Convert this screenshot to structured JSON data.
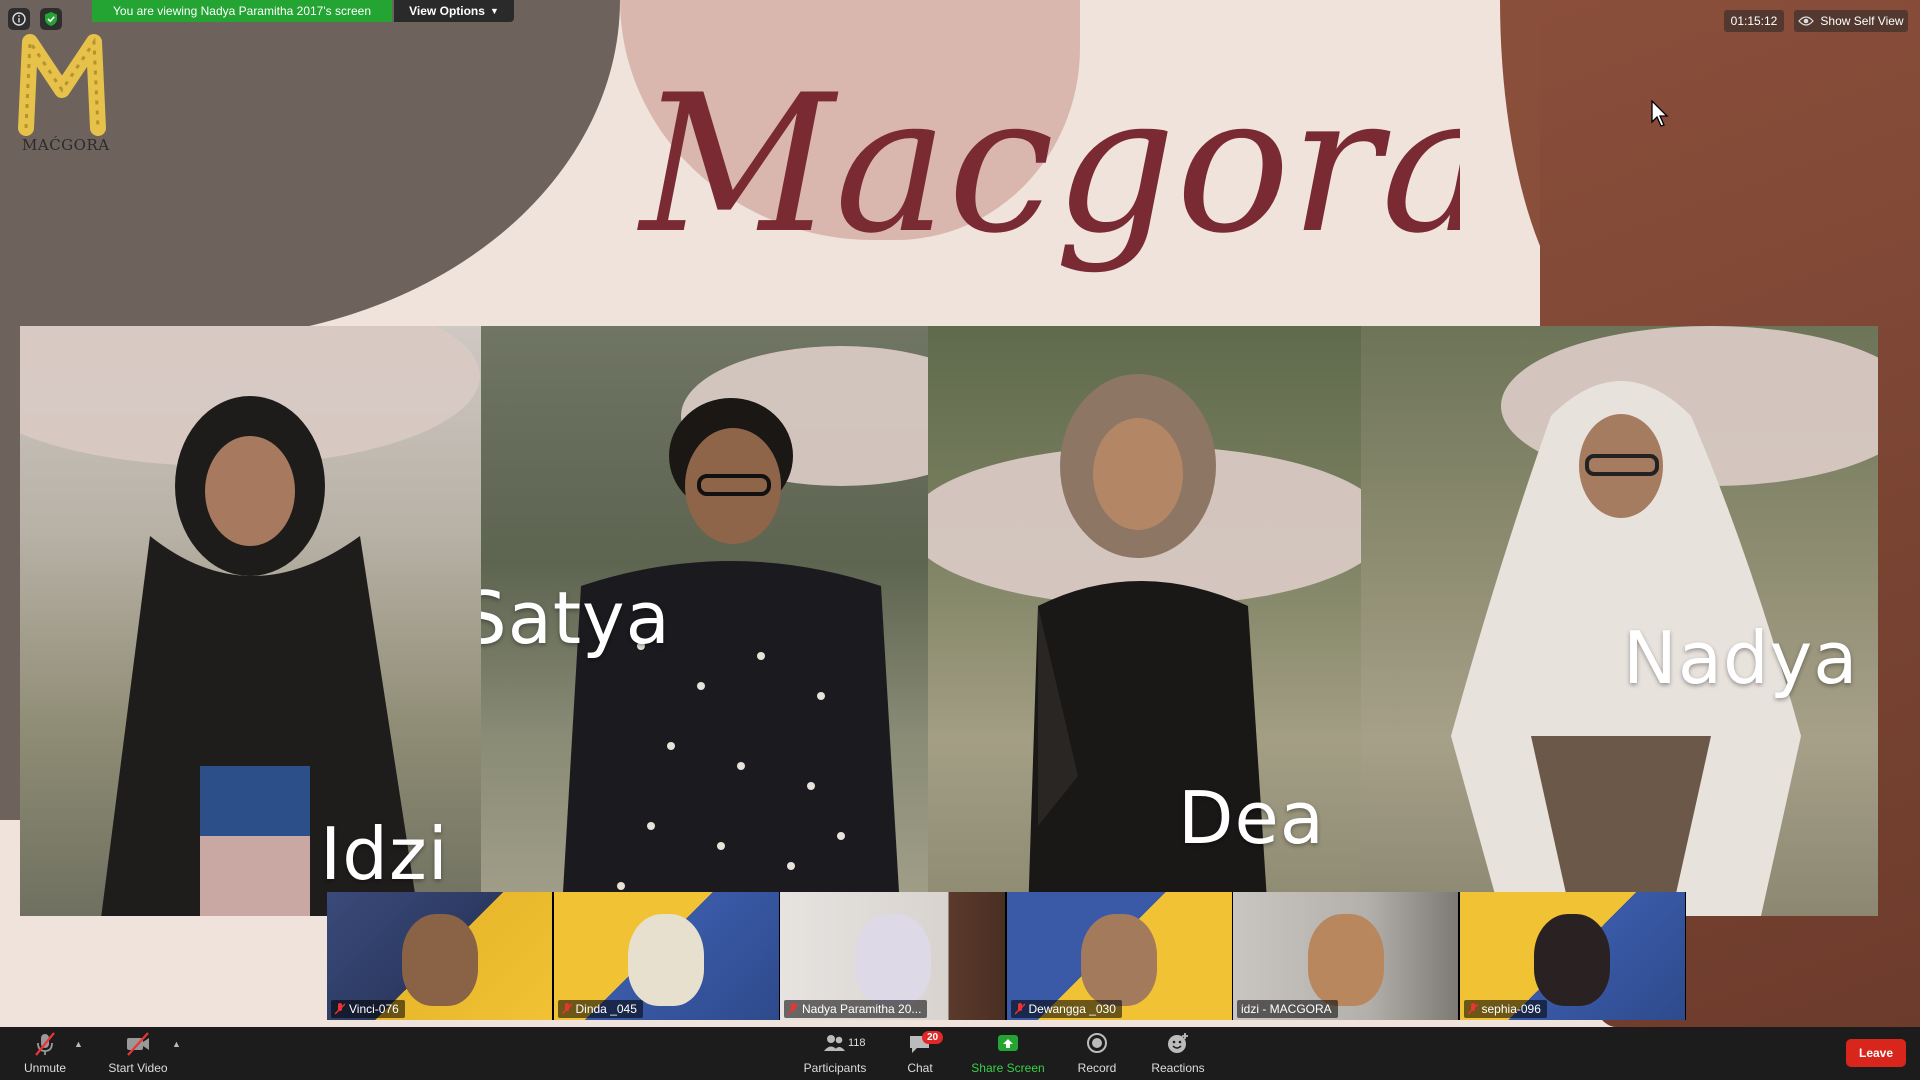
{
  "meeting": {
    "viewing_banner": "You are viewing Nadya Paramitha 2017's screen",
    "view_options_label": "View Options",
    "timer": "01:15:12",
    "self_view_label": "Show Self View"
  },
  "slide": {
    "brand_text": "MAĆGORA",
    "script_title": "Macgora",
    "members": [
      {
        "name": "Idzi"
      },
      {
        "name": "Satya"
      },
      {
        "name": "Dea"
      },
      {
        "name": "Nadya"
      }
    ]
  },
  "participants_strip": [
    {
      "name": "Vinci-076"
    },
    {
      "name": "Dinda _045"
    },
    {
      "name": "Nadya Paramitha 20..."
    },
    {
      "name": "Dewangga _030"
    },
    {
      "name": "idzi - MACGORA"
    },
    {
      "name": "sephia-096"
    }
  ],
  "toolbar": {
    "unmute_label": "Unmute",
    "start_video_label": "Start Video",
    "participants_label": "Participants",
    "participants_count": "118",
    "chat_label": "Chat",
    "chat_badge": "20",
    "share_screen_label": "Share Screen",
    "record_label": "Record",
    "reactions_label": "Reactions",
    "leave_label": "Leave"
  },
  "colors": {
    "share_green": "#23a433",
    "leave_red": "#d9261c",
    "title_maroon": "#7a2a33"
  }
}
